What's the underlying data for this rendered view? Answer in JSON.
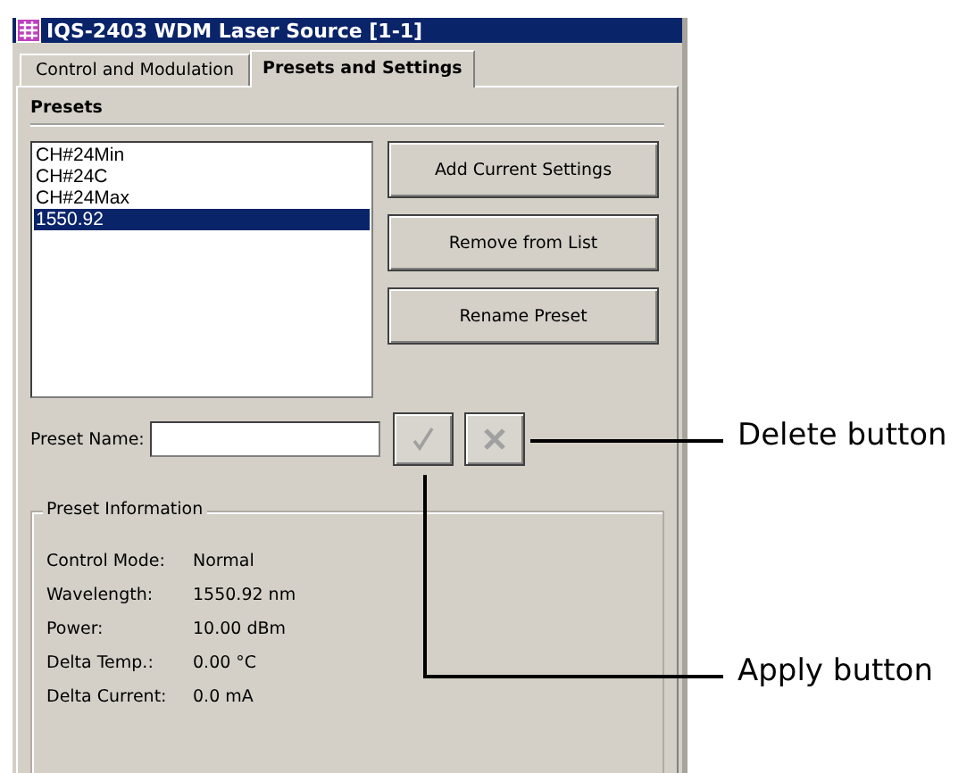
{
  "window": {
    "title": "IQS-2403 WDM Laser Source [1-1]"
  },
  "tabs": [
    {
      "label": "Control and Modulation",
      "selected": false
    },
    {
      "label": "Presets and Settings",
      "selected": true
    }
  ],
  "presets": {
    "heading": "Presets",
    "list": [
      {
        "label": "CH#24Min",
        "selected": false
      },
      {
        "label": "CH#24C",
        "selected": false
      },
      {
        "label": "CH#24Max",
        "selected": false
      },
      {
        "label": "1550.92",
        "selected": true
      }
    ],
    "buttons": [
      "Add Current Settings",
      "Remove from List",
      "Rename Preset"
    ],
    "preset_name": {
      "label": "Preset Name:"
    },
    "icon_buttons": [
      {
        "kind": "apply",
        "disabled": true
      },
      {
        "kind": "delete",
        "disabled": true
      }
    ]
  },
  "preset_information": {
    "title": "Preset Information",
    "rows": [
      {
        "label": "Control Mode:",
        "value": "Normal"
      },
      {
        "label": "Wavelength:",
        "value": "1550.92 nm"
      },
      {
        "label": "Power:",
        "value": "10.00 dBm"
      },
      {
        "label": "Delta Temp.:",
        "value": "0.00 °C"
      },
      {
        "label": "Delta Current:",
        "value": "0.0 mA"
      }
    ]
  },
  "callouts": [
    {
      "text": "Delete button"
    },
    {
      "text": "Apply button"
    }
  ]
}
